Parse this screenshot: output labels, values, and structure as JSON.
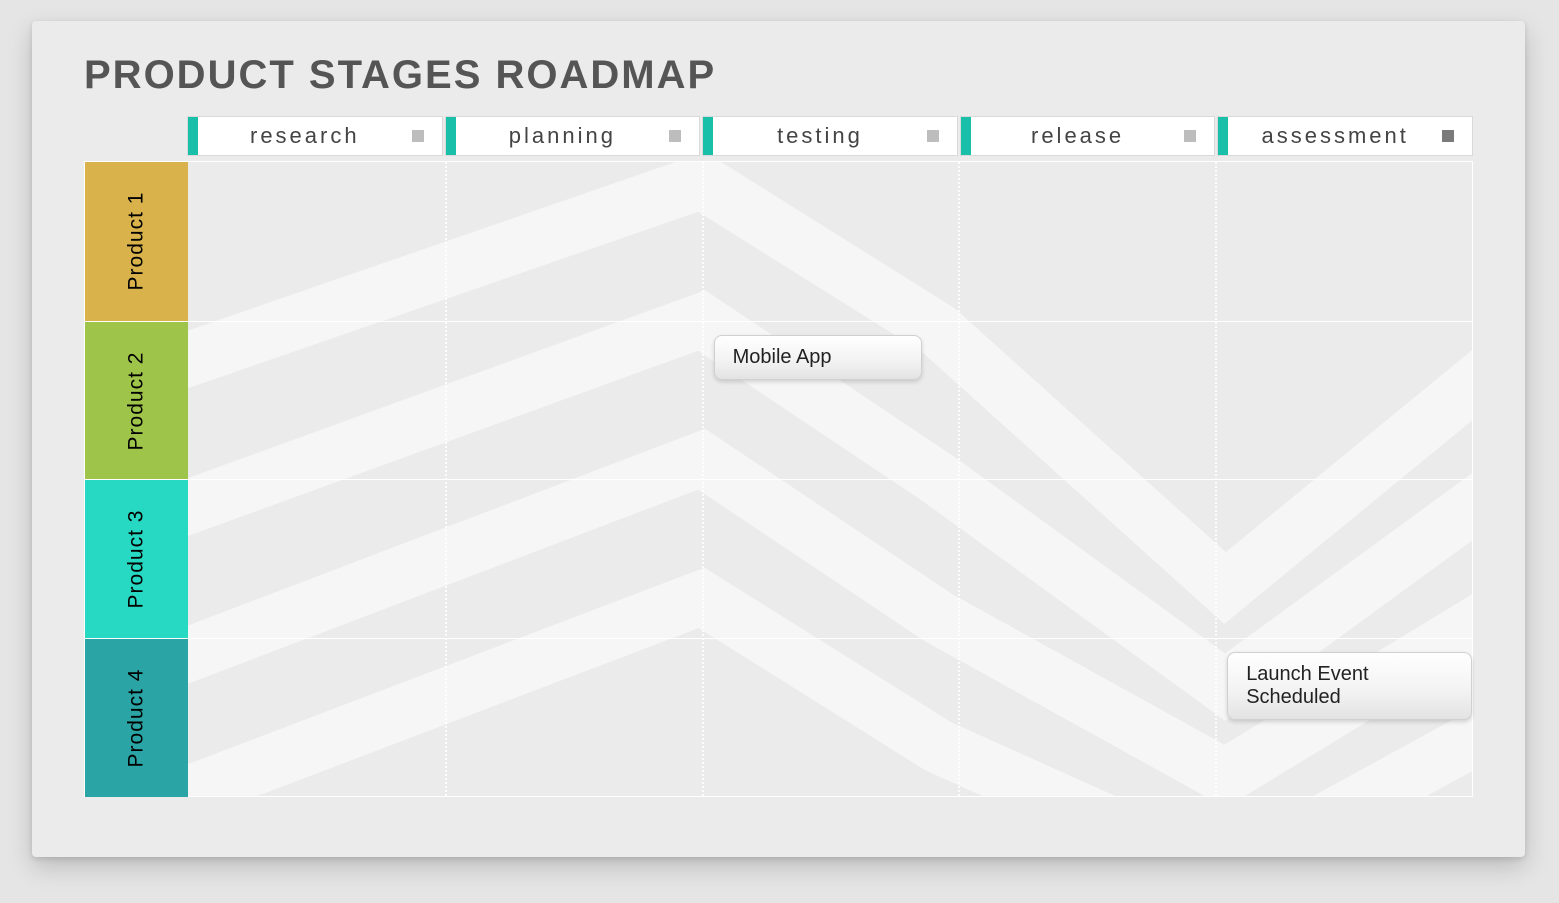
{
  "title": "PRODUCT STAGES ROADMAP",
  "stages": [
    "research",
    "planning",
    "testing",
    "release",
    "assessment"
  ],
  "products": [
    {
      "label": "Product 1",
      "color": "#d9b24b"
    },
    {
      "label": "Product 2",
      "color": "#9fc44a"
    },
    {
      "label": "Product 3",
      "color": "#27d9c2"
    },
    {
      "label": "Product 4",
      "color": "#2aa4a4"
    }
  ],
  "callouts": [
    {
      "text": "Mobile App",
      "row": 1,
      "stage": 2
    },
    {
      "text": "Launch Event Scheduled",
      "row": 3,
      "stage": 4
    }
  ]
}
